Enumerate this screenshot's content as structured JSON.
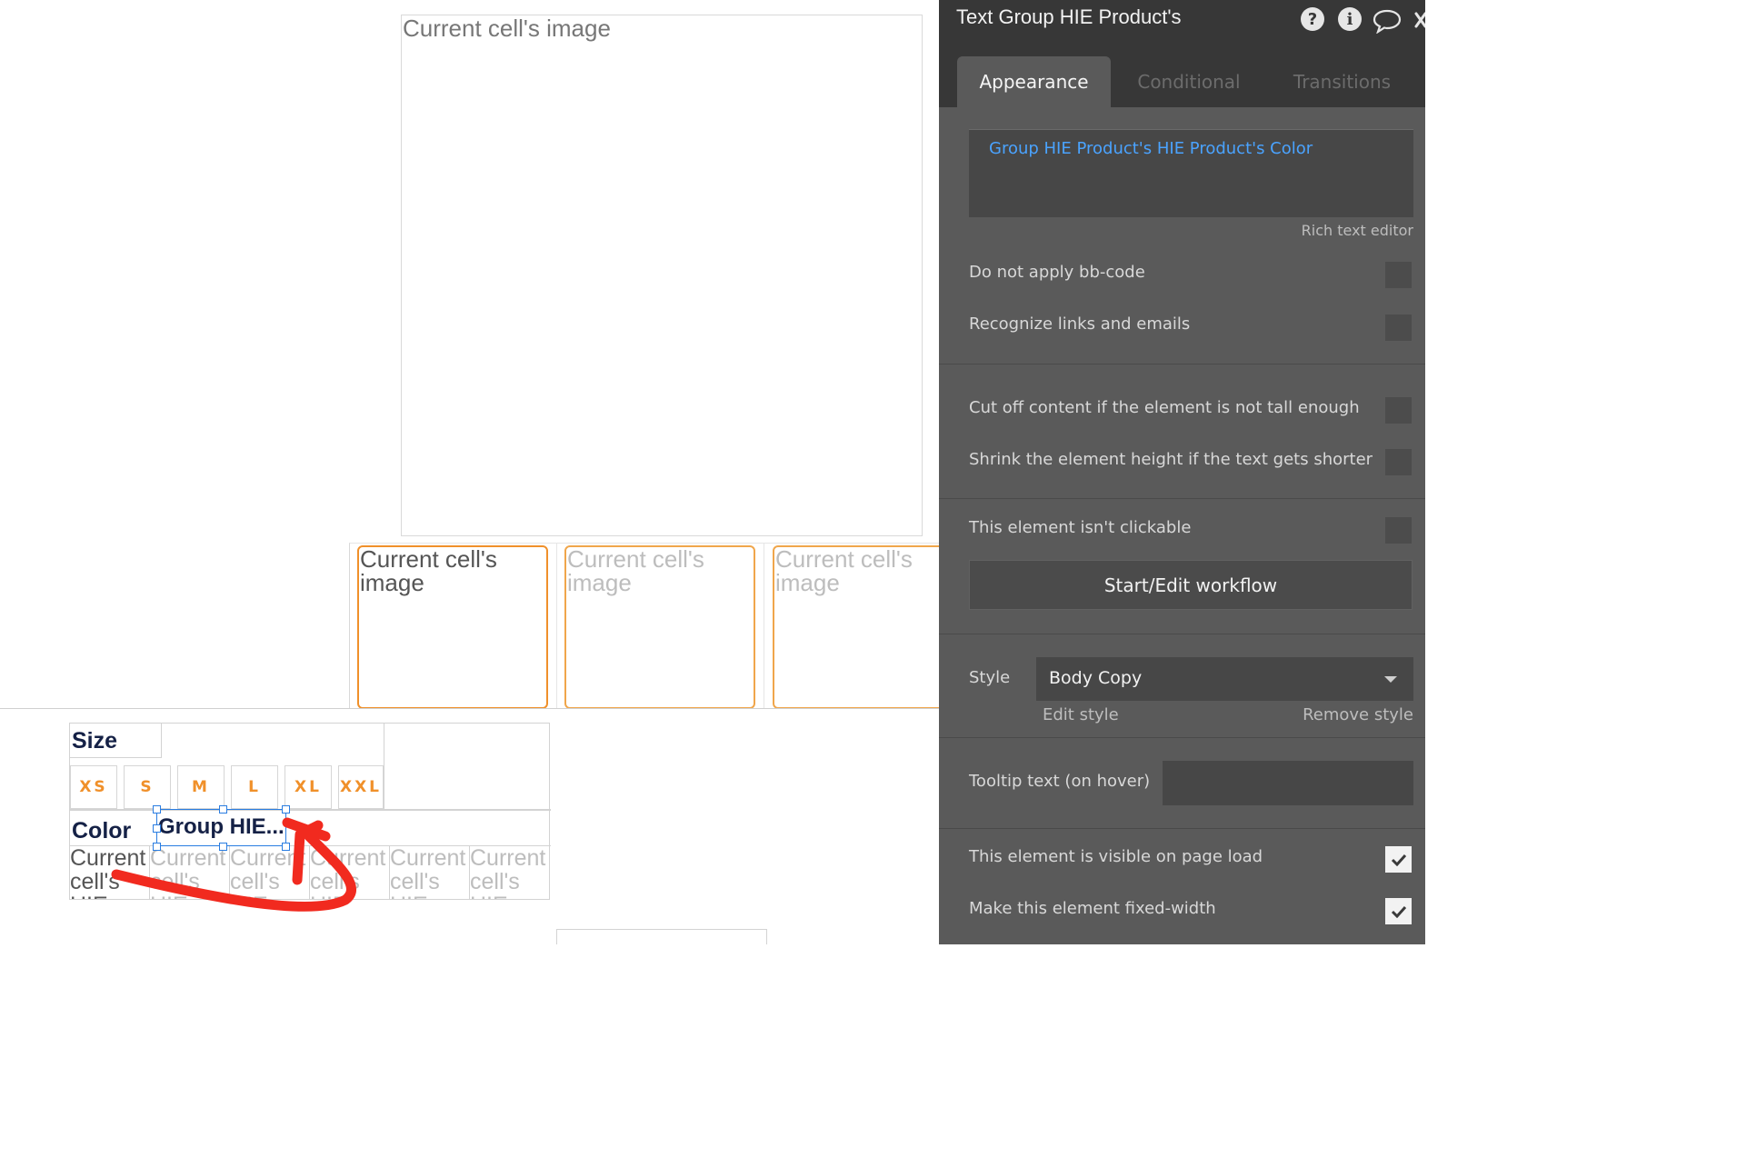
{
  "canvas": {
    "main_image_text": "Current cell's image",
    "thumbnails": [
      "Current cell's image",
      "Current cell's image",
      "Current cell's image"
    ],
    "size_label": "Size",
    "sizes": [
      "XS",
      "S",
      "M",
      "L",
      "XL",
      "XXL"
    ],
    "color_label": "Color",
    "selected_text": "Group HIE...",
    "color_cells": [
      "Current cell's HIE",
      "Current cell's HIE",
      "Current cell's HIE",
      "Current cell's HIE",
      "Current cell's HIE",
      "Current cell's HIE"
    ],
    "colors": {
      "accent_orange": "#f0902a",
      "selection_blue": "#2a7de1",
      "annotation_red": "#f12a1f"
    }
  },
  "panel": {
    "title": "Text Group HIE Product's",
    "icons": [
      "help-icon",
      "info-icon",
      "comment-icon",
      "close-icon"
    ],
    "icon_glyphs": {
      "help": "?",
      "info": "i"
    },
    "tabs": {
      "appearance": "Appearance",
      "conditional": "Conditional",
      "transitions": "Transitions"
    },
    "content_expression": "Group HIE Product's HIE Product's Color",
    "rich_text_editor": "Rich text editor",
    "options": {
      "bb_code": "Do not apply bb-code",
      "links": "Recognize links and emails",
      "cut_off": "Cut off content if the element is not tall enough",
      "shrink": "Shrink the element height if the text gets shorter",
      "not_clickable": "This element isn't clickable",
      "visible": "This element is visible on page load",
      "fixed_width": "Make this element fixed-width"
    },
    "workflow_button": "Start/Edit workflow",
    "style_label": "Style",
    "style_value": "Body Copy",
    "edit_style": "Edit style",
    "remove_style": "Remove style",
    "tooltip_label": "Tooltip text (on hover)",
    "colors": {
      "panel_bg": "#5a5a5a",
      "header_bg": "#373737",
      "expression_blue": "#4aa3ff"
    }
  }
}
